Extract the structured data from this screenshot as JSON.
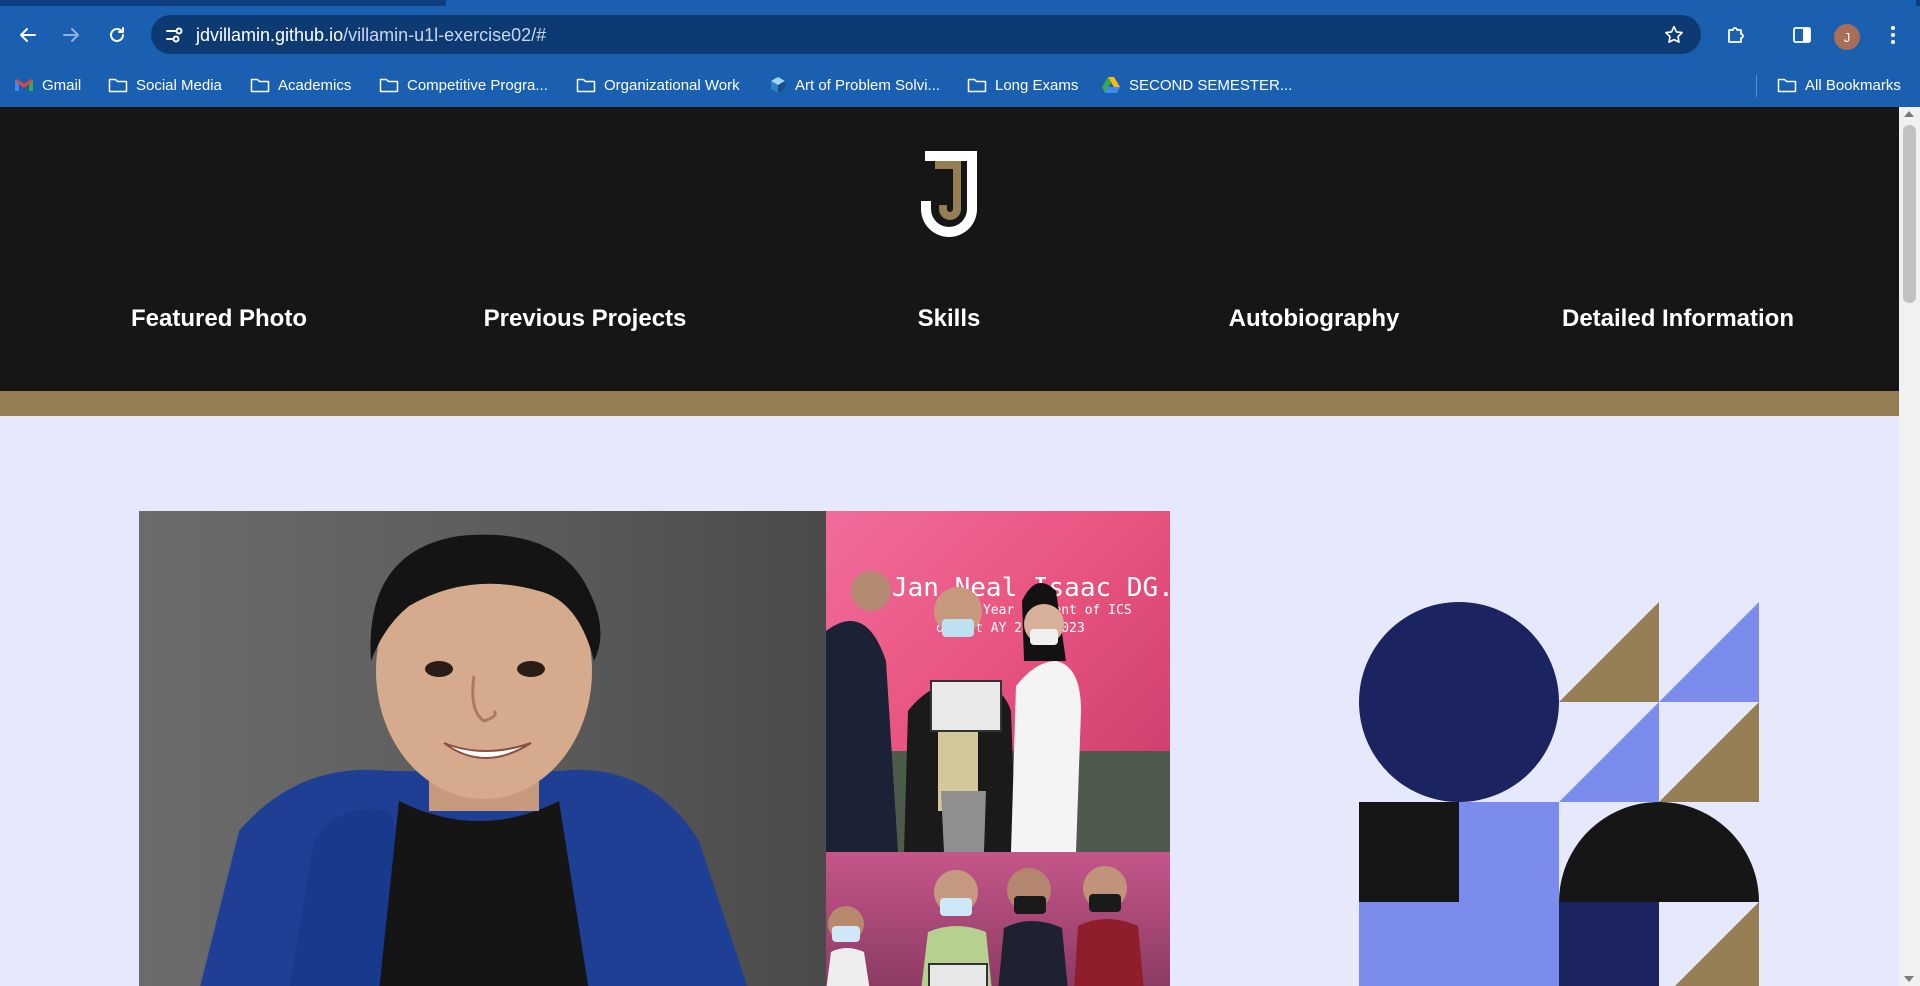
{
  "browser": {
    "url_host": "jdvillamin.github.io",
    "url_path": "/villamin-u1l-exercise02/#",
    "avatar_letter": "J",
    "bookmarks": [
      {
        "label": "Gmail",
        "icon": "gmail-icon"
      },
      {
        "label": "Social Media",
        "icon": "folder-icon"
      },
      {
        "label": "Academics",
        "icon": "folder-icon"
      },
      {
        "label": "Competitive Progra...",
        "icon": "folder-icon"
      },
      {
        "label": "Organizational Work",
        "icon": "folder-icon"
      },
      {
        "label": "Art of Problem Solvi...",
        "icon": "aops-icon"
      },
      {
        "label": "Long Exams",
        "icon": "folder-icon"
      },
      {
        "label": "SECOND SEMESTER...",
        "icon": "drive-icon"
      }
    ],
    "all_bookmarks": "All Bookmarks"
  },
  "site": {
    "nav": [
      {
        "label": "Featured Photo"
      },
      {
        "label": "Previous Projects"
      },
      {
        "label": "Skills"
      },
      {
        "label": "Autobiography"
      },
      {
        "label": "Detailed Information"
      }
    ],
    "photo_caption": {
      "line1": "Jan Neal Isaac DG. Vill",
      "line2": "First Year Student of ICS",
      "line3": "of 1st   AY 2022-2023"
    }
  },
  "colors": {
    "chrome_blue": "#1a5fb0",
    "omnibox": "#0e3a73",
    "header_black": "#161616",
    "gold": "#957e54",
    "page_bg": "#e6e8fb",
    "navy": "#1b2360",
    "periwinkle": "#7b8ced"
  }
}
